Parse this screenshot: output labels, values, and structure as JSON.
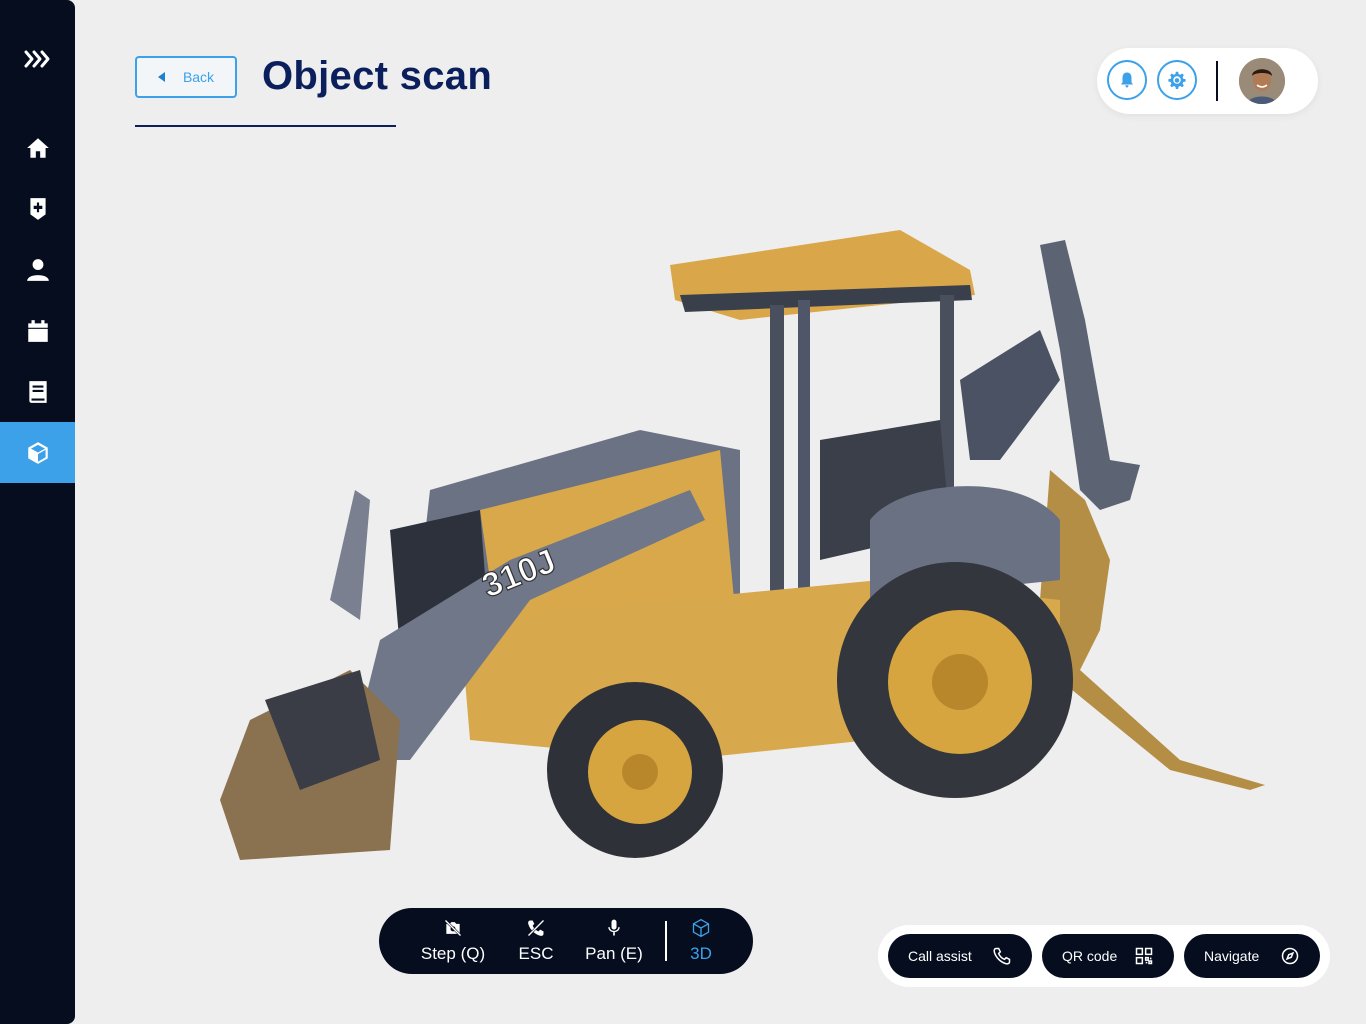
{
  "header": {
    "back_label": "Back",
    "title": "Object scan"
  },
  "sidebar": {
    "items": [
      {
        "name": "logo",
        "icon": "chevrons-right-icon",
        "active": false
      },
      {
        "name": "home",
        "icon": "home-icon",
        "active": false
      },
      {
        "name": "medical",
        "icon": "medical-plus-icon",
        "active": false
      },
      {
        "name": "user",
        "icon": "user-icon",
        "active": false
      },
      {
        "name": "calendar",
        "icon": "calendar-icon",
        "active": false
      },
      {
        "name": "book",
        "icon": "book-icon",
        "active": false
      },
      {
        "name": "object-scan",
        "icon": "cube-icon",
        "active": true
      }
    ]
  },
  "topbar": {
    "icons": [
      "bell-icon",
      "gear-icon"
    ],
    "avatar": "user-avatar"
  },
  "scan": {
    "model_text": "310J"
  },
  "toolbar": {
    "items": [
      {
        "label": "Step (Q)",
        "icon": "camera-off-icon"
      },
      {
        "label": "ESC",
        "icon": "phone-off-icon"
      },
      {
        "label": "Pan (E)",
        "icon": "mic-icon"
      },
      {
        "label": "3D",
        "icon": "cube-icon",
        "active": true
      }
    ]
  },
  "actions": [
    {
      "label": "Call assist",
      "icon": "phone-icon"
    },
    {
      "label": "QR code",
      "icon": "qr-code-icon"
    },
    {
      "label": "Navigate",
      "icon": "compass-icon"
    }
  ],
  "colors": {
    "accent": "#3ca1e8",
    "sidebar": "#050d1f",
    "title": "#0b1f5c",
    "background": "#eeeeee"
  }
}
